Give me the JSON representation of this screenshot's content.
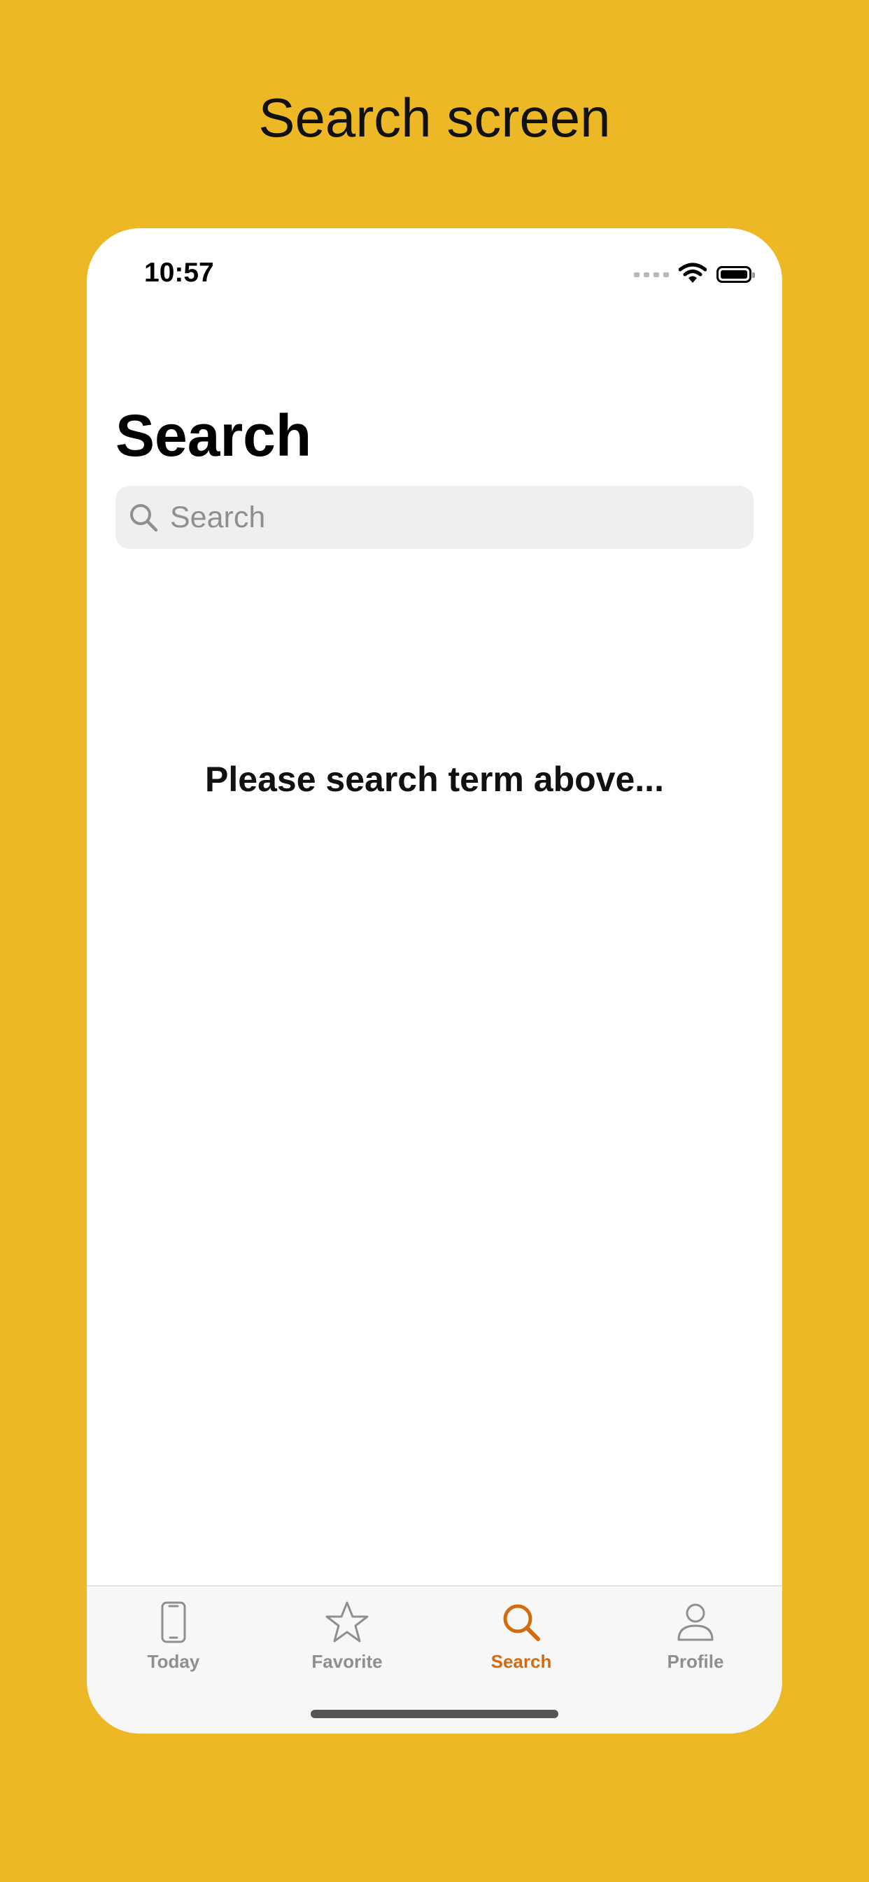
{
  "caption": "Search screen",
  "status_bar": {
    "time": "10:57"
  },
  "page": {
    "title": "Search"
  },
  "search": {
    "placeholder": "Search",
    "value": ""
  },
  "empty_state": {
    "message": "Please search term above..."
  },
  "tabs": [
    {
      "label": "Today",
      "icon": "phone-icon",
      "active": false
    },
    {
      "label": "Favorite",
      "icon": "star-icon",
      "active": false
    },
    {
      "label": "Search",
      "icon": "search-icon",
      "active": true
    },
    {
      "label": "Profile",
      "icon": "person-icon",
      "active": false
    }
  ],
  "colors": {
    "background": "#EDB825",
    "accent": "#D36B12",
    "inactive": "#8E8E93",
    "search_field": "#EFEFF0"
  }
}
